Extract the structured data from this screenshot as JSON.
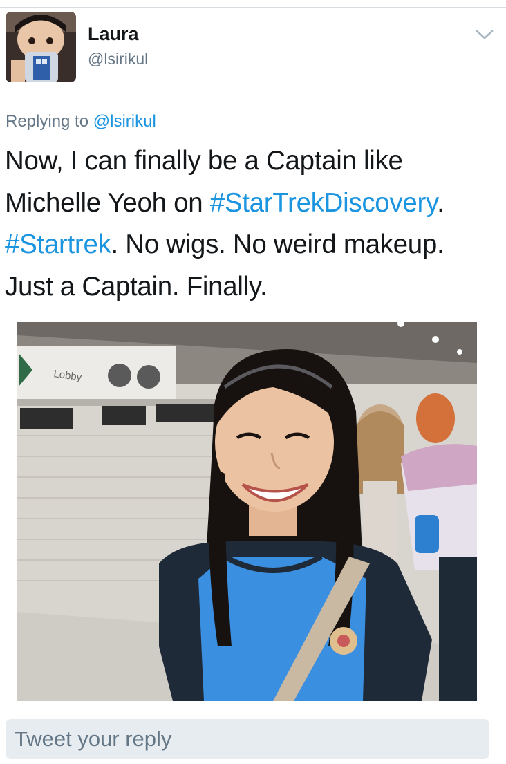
{
  "user": {
    "display_name": "Laura",
    "handle": "@lsirikul"
  },
  "icons": {
    "menu": "chevron-down-icon"
  },
  "reply": {
    "prefix": "Replying to",
    "mention": "@lsirikul"
  },
  "tweet": {
    "text_1": "Now, I can finally be a Captain like Michelle Yeoh on",
    "hashtag_1": "#StarTrekDiscovery",
    "text_2": ".",
    "hashtag_2": "#Startrek",
    "text_3": ". No wigs. No weird makeup. Just a Captain. Finally."
  },
  "photo": {
    "sign_text": "Lobby"
  },
  "composer": {
    "placeholder": "Tweet your reply"
  },
  "colors": {
    "link": "#1b95e0",
    "text": "#14171a",
    "muted": "#657786",
    "composer_bg": "#e6ecf0"
  }
}
